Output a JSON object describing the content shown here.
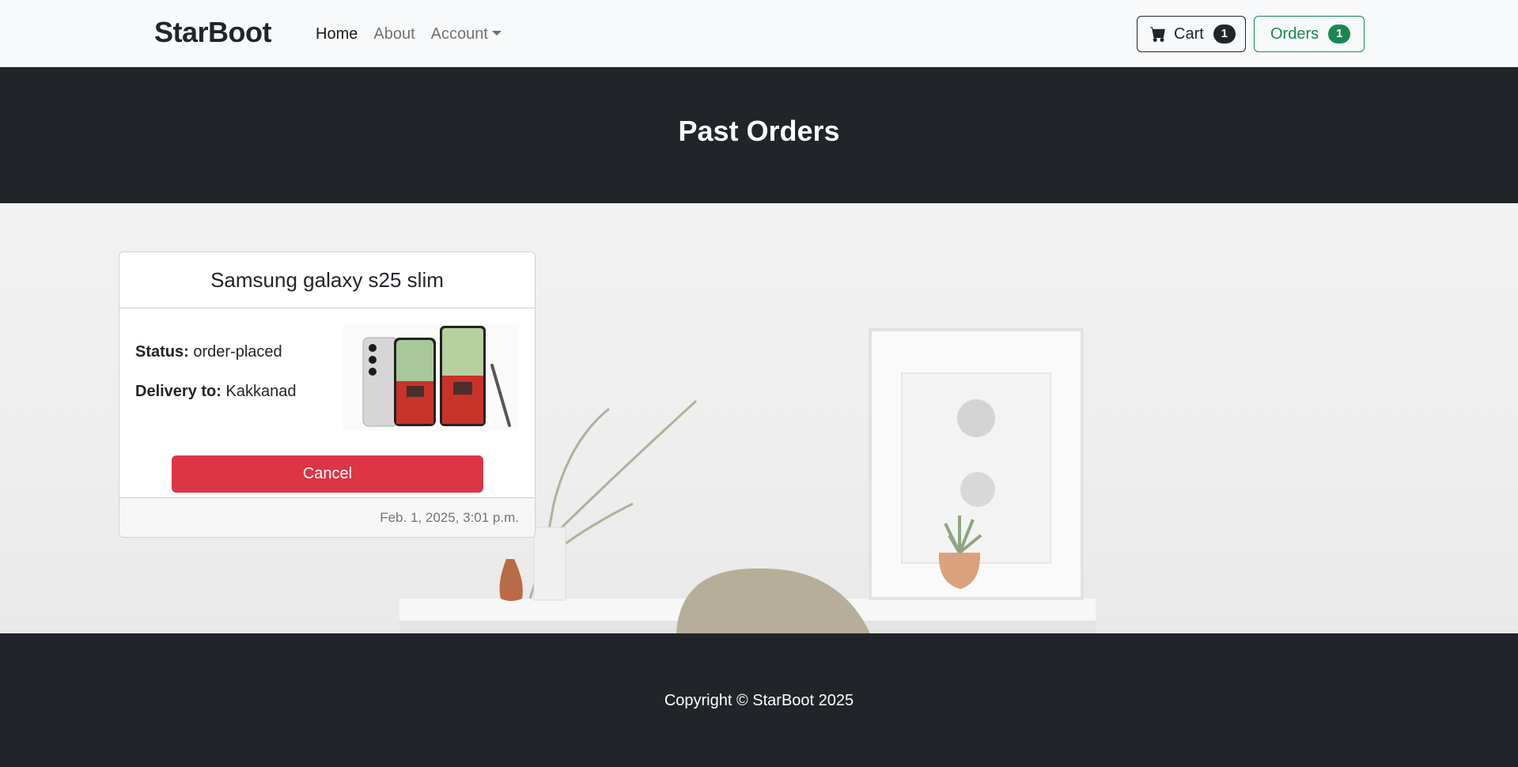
{
  "navbar": {
    "brand": "StarBoot",
    "links": [
      {
        "label": "Home",
        "active": true
      },
      {
        "label": "About",
        "active": false
      },
      {
        "label": "Account",
        "active": false,
        "dropdown": true
      }
    ],
    "cart": {
      "label": "Cart",
      "count": "1",
      "icon": "cart-icon"
    },
    "orders": {
      "label": "Orders",
      "count": "1"
    }
  },
  "header": {
    "title": "Past Orders"
  },
  "order": {
    "product_name": "Samsung galaxy s25 slim",
    "status_label": "Status:",
    "status_value": "order-placed",
    "delivery_label": "Delivery to:",
    "delivery_value": "Kakkanad",
    "cancel_label": "Cancel",
    "timestamp": "Feb. 1, 2025, 3:01 p.m."
  },
  "footer": {
    "copyright": "Copyright © StarBoot 2025"
  },
  "colors": {
    "dark": "#212529",
    "success": "#198754",
    "danger": "#dc3545",
    "navbar_bg": "#f8f9fa"
  }
}
